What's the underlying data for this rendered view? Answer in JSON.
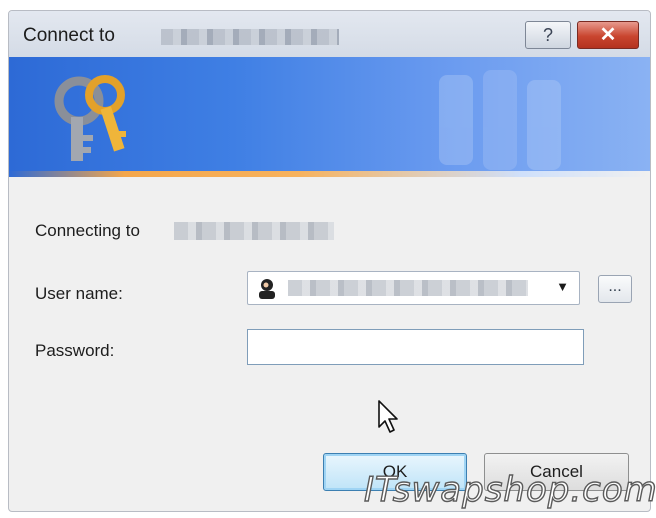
{
  "window": {
    "title": "Connect to",
    "help_glyph": "?",
    "close_glyph": "✕"
  },
  "connecting": {
    "label": "Connecting to"
  },
  "form": {
    "username_label": "User name:",
    "password_label": "Password:",
    "username_value": "",
    "password_value": "",
    "browse_label": "..."
  },
  "buttons": {
    "ok": "OK",
    "cancel": "Cancel"
  },
  "icons": {
    "banner": "keys-icon",
    "user": "user-icon",
    "dropdown": "chevron-down-icon",
    "cursor": "mouse-pointer-icon"
  },
  "colors": {
    "banner": "#3f7fe4",
    "close": "#c9452f",
    "ok_border": "#3c7fb1"
  },
  "watermark": "ITswapshop.com"
}
